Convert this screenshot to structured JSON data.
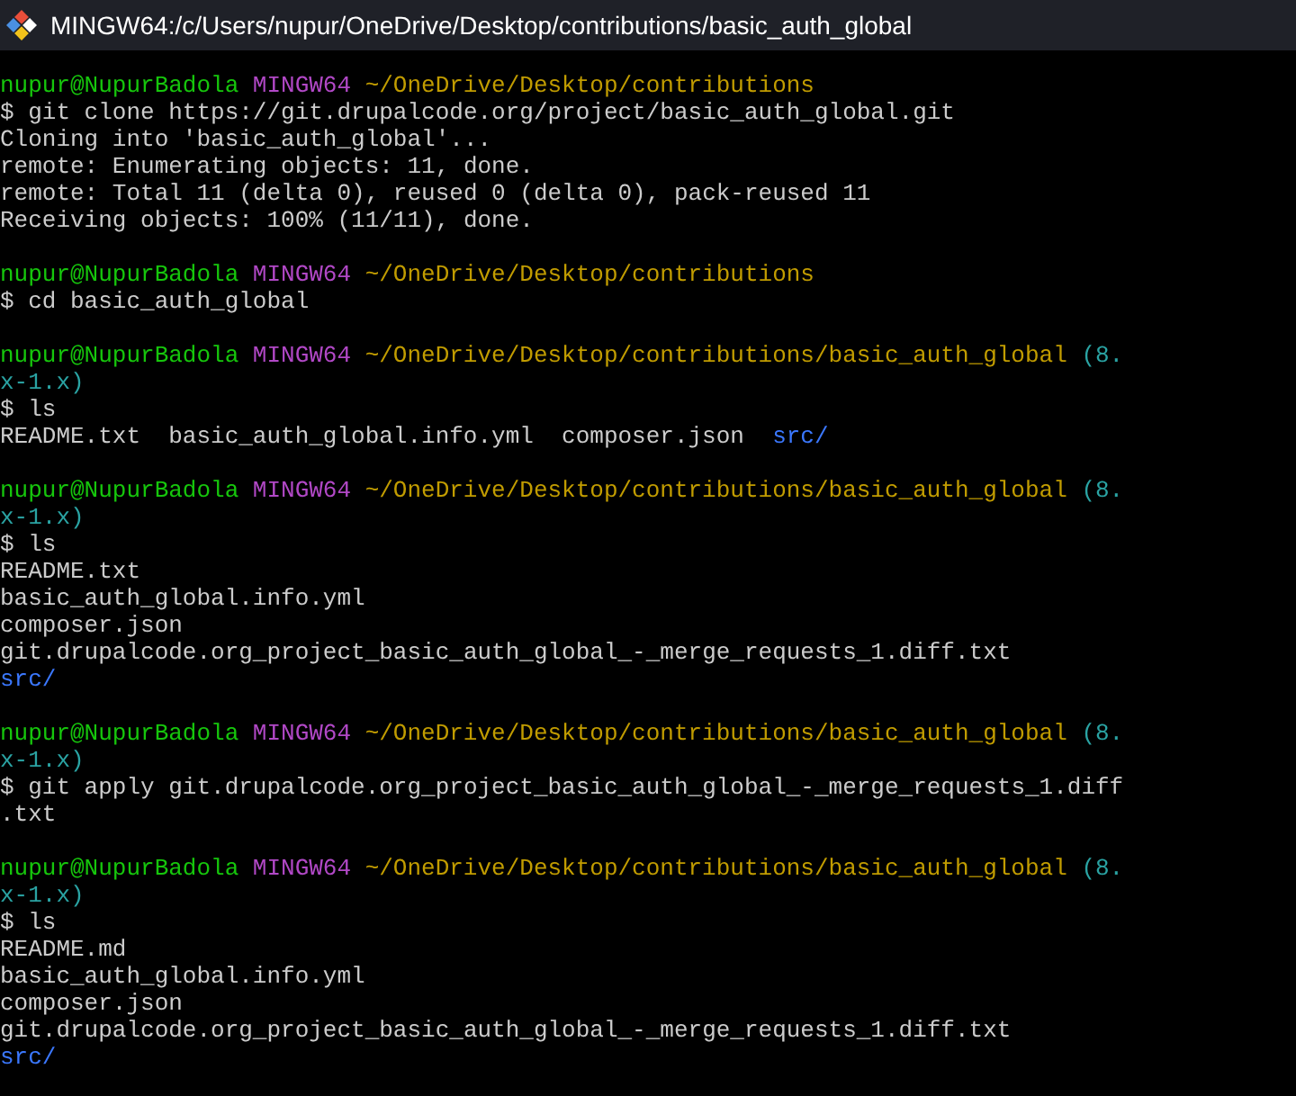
{
  "window": {
    "title": "MINGW64:/c/Users/nupur/OneDrive/Desktop/contributions/basic_auth_global"
  },
  "terminal": {
    "blocks": [
      {
        "lines": [
          {
            "kind": "prompt",
            "segments": [
              {
                "kind": "user",
                "text": "nupur@NupurBadola"
              },
              {
                "kind": "host",
                "text": "MINGW64"
              },
              {
                "kind": "path",
                "text": "~/OneDrive/Desktop/contributions"
              }
            ]
          },
          {
            "kind": "output",
            "segments": [
              {
                "kind": "plain",
                "text": "$ git clone https://git.drupalcode.org/project/basic_auth_global.git"
              }
            ]
          },
          {
            "kind": "output",
            "segments": [
              {
                "kind": "plain",
                "text": "Cloning into 'basic_auth_global'..."
              }
            ]
          },
          {
            "kind": "output",
            "segments": [
              {
                "kind": "plain",
                "text": "remote: Enumerating objects: 11, done."
              }
            ]
          },
          {
            "kind": "output",
            "segments": [
              {
                "kind": "plain",
                "text": "remote: Total 11 (delta 0), reused 0 (delta 0), pack-reused 11"
              }
            ]
          },
          {
            "kind": "output",
            "segments": [
              {
                "kind": "plain",
                "text": "Receiving objects: 100% (11/11), done."
              }
            ]
          }
        ]
      },
      {
        "lines": [
          {
            "kind": "prompt",
            "segments": [
              {
                "kind": "user",
                "text": "nupur@NupurBadola"
              },
              {
                "kind": "host",
                "text": "MINGW64"
              },
              {
                "kind": "path",
                "text": "~/OneDrive/Desktop/contributions"
              }
            ]
          },
          {
            "kind": "output",
            "segments": [
              {
                "kind": "plain",
                "text": "$ cd basic_auth_global"
              }
            ]
          }
        ]
      },
      {
        "lines": [
          {
            "kind": "prompt",
            "segments": [
              {
                "kind": "user",
                "text": "nupur@NupurBadola"
              },
              {
                "kind": "host",
                "text": "MINGW64"
              },
              {
                "kind": "path",
                "text": "~/OneDrive/Desktop/contributions/basic_auth_global"
              },
              {
                "kind": "branch",
                "text": "(8."
              }
            ]
          },
          {
            "kind": "output",
            "segments": [
              {
                "kind": "branch",
                "text": "x-1.x)"
              }
            ]
          },
          {
            "kind": "output",
            "segments": [
              {
                "kind": "plain",
                "text": "$ ls"
              }
            ]
          },
          {
            "kind": "listing",
            "segments": [
              {
                "kind": "plain",
                "text": "README.txt"
              },
              {
                "kind": "plain",
                "text": "basic_auth_global.info.yml"
              },
              {
                "kind": "plain",
                "text": "composer.json"
              },
              {
                "kind": "dir",
                "text": "src/"
              }
            ]
          }
        ]
      },
      {
        "lines": [
          {
            "kind": "prompt",
            "segments": [
              {
                "kind": "user",
                "text": "nupur@NupurBadola"
              },
              {
                "kind": "host",
                "text": "MINGW64"
              },
              {
                "kind": "path",
                "text": "~/OneDrive/Desktop/contributions/basic_auth_global"
              },
              {
                "kind": "branch",
                "text": "(8."
              }
            ]
          },
          {
            "kind": "output",
            "segments": [
              {
                "kind": "branch",
                "text": "x-1.x)"
              }
            ]
          },
          {
            "kind": "output",
            "segments": [
              {
                "kind": "plain",
                "text": "$ ls"
              }
            ]
          },
          {
            "kind": "output",
            "segments": [
              {
                "kind": "plain",
                "text": "README.txt"
              }
            ]
          },
          {
            "kind": "output",
            "segments": [
              {
                "kind": "plain",
                "text": "basic_auth_global.info.yml"
              }
            ]
          },
          {
            "kind": "output",
            "segments": [
              {
                "kind": "plain",
                "text": "composer.json"
              }
            ]
          },
          {
            "kind": "output",
            "segments": [
              {
                "kind": "plain",
                "text": "git.drupalcode.org_project_basic_auth_global_-_merge_requests_1.diff.txt"
              }
            ]
          },
          {
            "kind": "output",
            "segments": [
              {
                "kind": "dir",
                "text": "src/"
              }
            ]
          }
        ]
      },
      {
        "lines": [
          {
            "kind": "prompt",
            "segments": [
              {
                "kind": "user",
                "text": "nupur@NupurBadola"
              },
              {
                "kind": "host",
                "text": "MINGW64"
              },
              {
                "kind": "path",
                "text": "~/OneDrive/Desktop/contributions/basic_auth_global"
              },
              {
                "kind": "branch",
                "text": "(8."
              }
            ]
          },
          {
            "kind": "output",
            "segments": [
              {
                "kind": "branch",
                "text": "x-1.x)"
              }
            ]
          },
          {
            "kind": "output",
            "segments": [
              {
                "kind": "plain",
                "text": "$ git apply git.drupalcode.org_project_basic_auth_global_-_merge_requests_1.diff"
              }
            ]
          },
          {
            "kind": "output",
            "segments": [
              {
                "kind": "plain",
                "text": ".txt"
              }
            ]
          }
        ]
      },
      {
        "lines": [
          {
            "kind": "prompt",
            "segments": [
              {
                "kind": "user",
                "text": "nupur@NupurBadola"
              },
              {
                "kind": "host",
                "text": "MINGW64"
              },
              {
                "kind": "path",
                "text": "~/OneDrive/Desktop/contributions/basic_auth_global"
              },
              {
                "kind": "branch",
                "text": "(8."
              }
            ]
          },
          {
            "kind": "output",
            "segments": [
              {
                "kind": "branch",
                "text": "x-1.x)"
              }
            ]
          },
          {
            "kind": "output",
            "segments": [
              {
                "kind": "plain",
                "text": "$ ls"
              }
            ]
          },
          {
            "kind": "output",
            "segments": [
              {
                "kind": "plain",
                "text": "README.md"
              }
            ]
          },
          {
            "kind": "output",
            "segments": [
              {
                "kind": "plain",
                "text": "basic_auth_global.info.yml"
              }
            ]
          },
          {
            "kind": "output",
            "segments": [
              {
                "kind": "plain",
                "text": "composer.json"
              }
            ]
          },
          {
            "kind": "output",
            "segments": [
              {
                "kind": "plain",
                "text": "git.drupalcode.org_project_basic_auth_global_-_merge_requests_1.diff.txt"
              }
            ]
          },
          {
            "kind": "output",
            "segments": [
              {
                "kind": "dir",
                "text": "src/"
              }
            ]
          }
        ]
      }
    ]
  }
}
